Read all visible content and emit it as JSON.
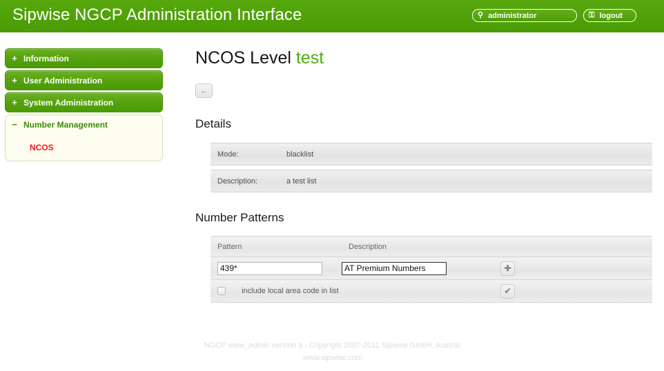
{
  "header": {
    "title": "Sipwise NGCP Administration Interface",
    "user_button": {
      "label": "administrator",
      "icon": "user-icon",
      "glyph": "⚲"
    },
    "logout_button": {
      "label": "logout",
      "icon": "lock-icon",
      "glyph": "⚿"
    },
    "background_color": "#4c9e08"
  },
  "sidebar": {
    "items": [
      {
        "label": "Information",
        "sign": "+",
        "expanded": false
      },
      {
        "label": "User Administration",
        "sign": "+",
        "expanded": false
      },
      {
        "label": "System Administration",
        "sign": "+",
        "expanded": false
      },
      {
        "label": "Number Management",
        "sign": "−",
        "expanded": true
      }
    ],
    "sub_items": [
      {
        "label": "NCOS",
        "color": "#f21919",
        "active": true
      }
    ]
  },
  "main": {
    "page_title_prefix": "NCOS Level",
    "page_title_accent": "test",
    "back_button": {
      "icon": "arrow-left-icon",
      "glyph": "←"
    },
    "details": {
      "heading": "Details",
      "rows": [
        {
          "label": "Mode:",
          "value": "blacklist"
        },
        {
          "label": "Description:",
          "value": "a test list"
        }
      ]
    },
    "number_patterns": {
      "heading": "Number Patterns",
      "columns": [
        "Pattern",
        "Description"
      ],
      "entry_row": {
        "pattern_value": "439*",
        "pattern_placeholder": "",
        "description_value": "AT Premium Numbers",
        "description_placeholder": "",
        "add_button": {
          "icon": "plus-icon",
          "glyph": "✚"
        }
      },
      "option_row": {
        "checkbox_label": "include local area code in list",
        "checked": false,
        "confirm_button": {
          "icon": "check-icon",
          "glyph": "✔"
        }
      }
    }
  },
  "footer": {
    "line1": "NGCP www_admin version 3 - Copyright 2007-2011 Sipwise GmbH, Austria.",
    "line2": "www.sipwise.com"
  }
}
